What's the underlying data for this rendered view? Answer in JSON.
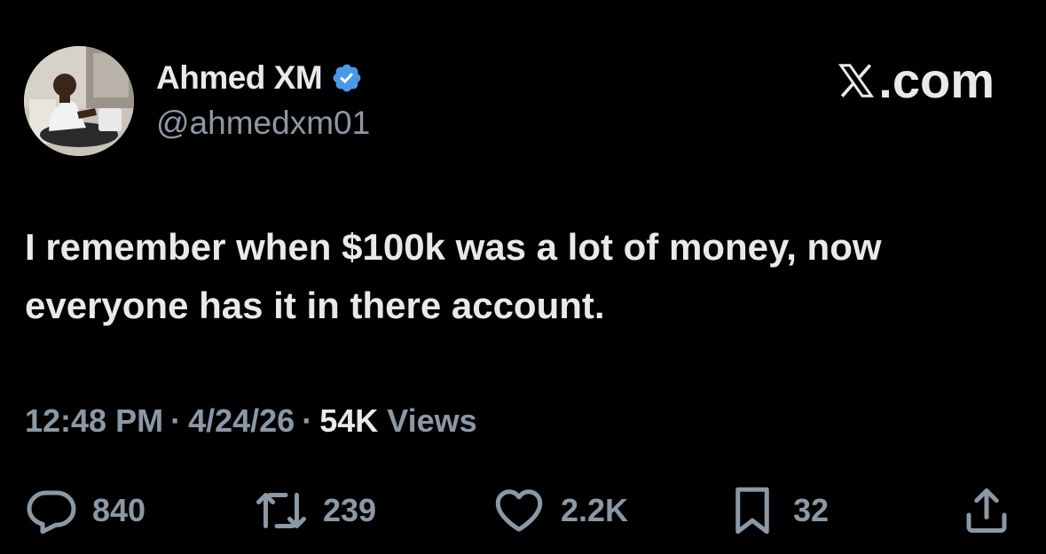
{
  "user": {
    "display_name": "Ahmed XM",
    "handle": "@ahmedxm01",
    "verified": true,
    "verified_color": "#4a99e9"
  },
  "brand": {
    "label": ".com"
  },
  "tweet": {
    "text": "I remember when $100k was a lot of money, now everyone has it in there account."
  },
  "meta": {
    "time": "12:48 PM",
    "date": "4/24/26",
    "separator": "·",
    "views_count": "54K",
    "views_label": "Views"
  },
  "actions": {
    "replies": "840",
    "reposts": "239",
    "likes": "2.2K",
    "bookmarks": "32"
  },
  "colors": {
    "background": "#000000",
    "primary_text": "#e7e9ea",
    "secondary_text": "#8b98a5"
  }
}
